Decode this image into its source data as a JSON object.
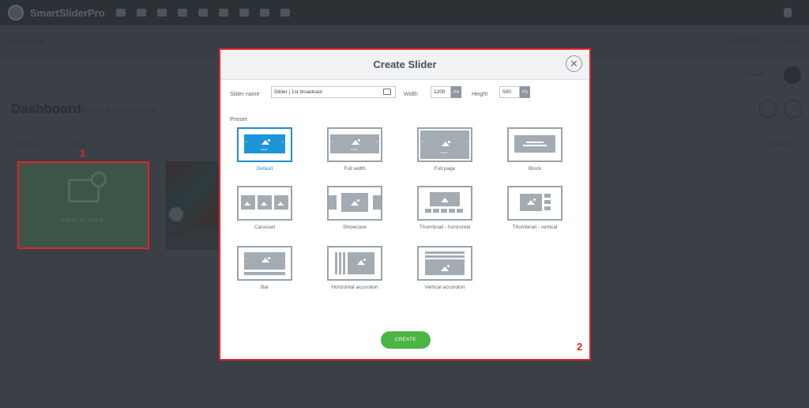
{
  "app": {
    "logo_text": "SmartSliderPro"
  },
  "subnav": {
    "breadcrumb": "Dashboard",
    "link_settings": "SETTINGS",
    "link_help": "HELP"
  },
  "dashboard": {
    "title": "Dashboard",
    "version": "Version 3.2.29 pro r6219 Changelog",
    "filter_order": "Order by",
    "filter_group": "Group",
    "sort": "Compact view",
    "upgrade_text": "Upgrade",
    "new_slider_label": "NEW SLIDER",
    "slide_name": "Slider",
    "marker_1": "1"
  },
  "modal": {
    "title": "Create Slider",
    "slider_name_label": "Slider name",
    "slider_name_value": "Slider | 1st broadcast",
    "width_label": "Width",
    "width_value": "1200",
    "height_label": "Height",
    "height_value": "500",
    "unit": "PX",
    "preset_label": "Preset",
    "presets": [
      {
        "label": "Default"
      },
      {
        "label": "Full width"
      },
      {
        "label": "Full page"
      },
      {
        "label": "Block"
      },
      {
        "label": "Carousel"
      },
      {
        "label": "Showcase"
      },
      {
        "label": "Thumbnail - horizontal"
      },
      {
        "label": "Thumbnail - vertical"
      },
      {
        "label": "Bar"
      },
      {
        "label": "Horizontal accordion"
      },
      {
        "label": "Vertical accordion"
      }
    ],
    "selected_preset": "Default",
    "create_label": "CREATE",
    "marker_2": "2"
  },
  "colors": {
    "accent_blue": "#1f8fcf",
    "create_green": "#4bb543",
    "highlight_red": "#e3222a"
  }
}
